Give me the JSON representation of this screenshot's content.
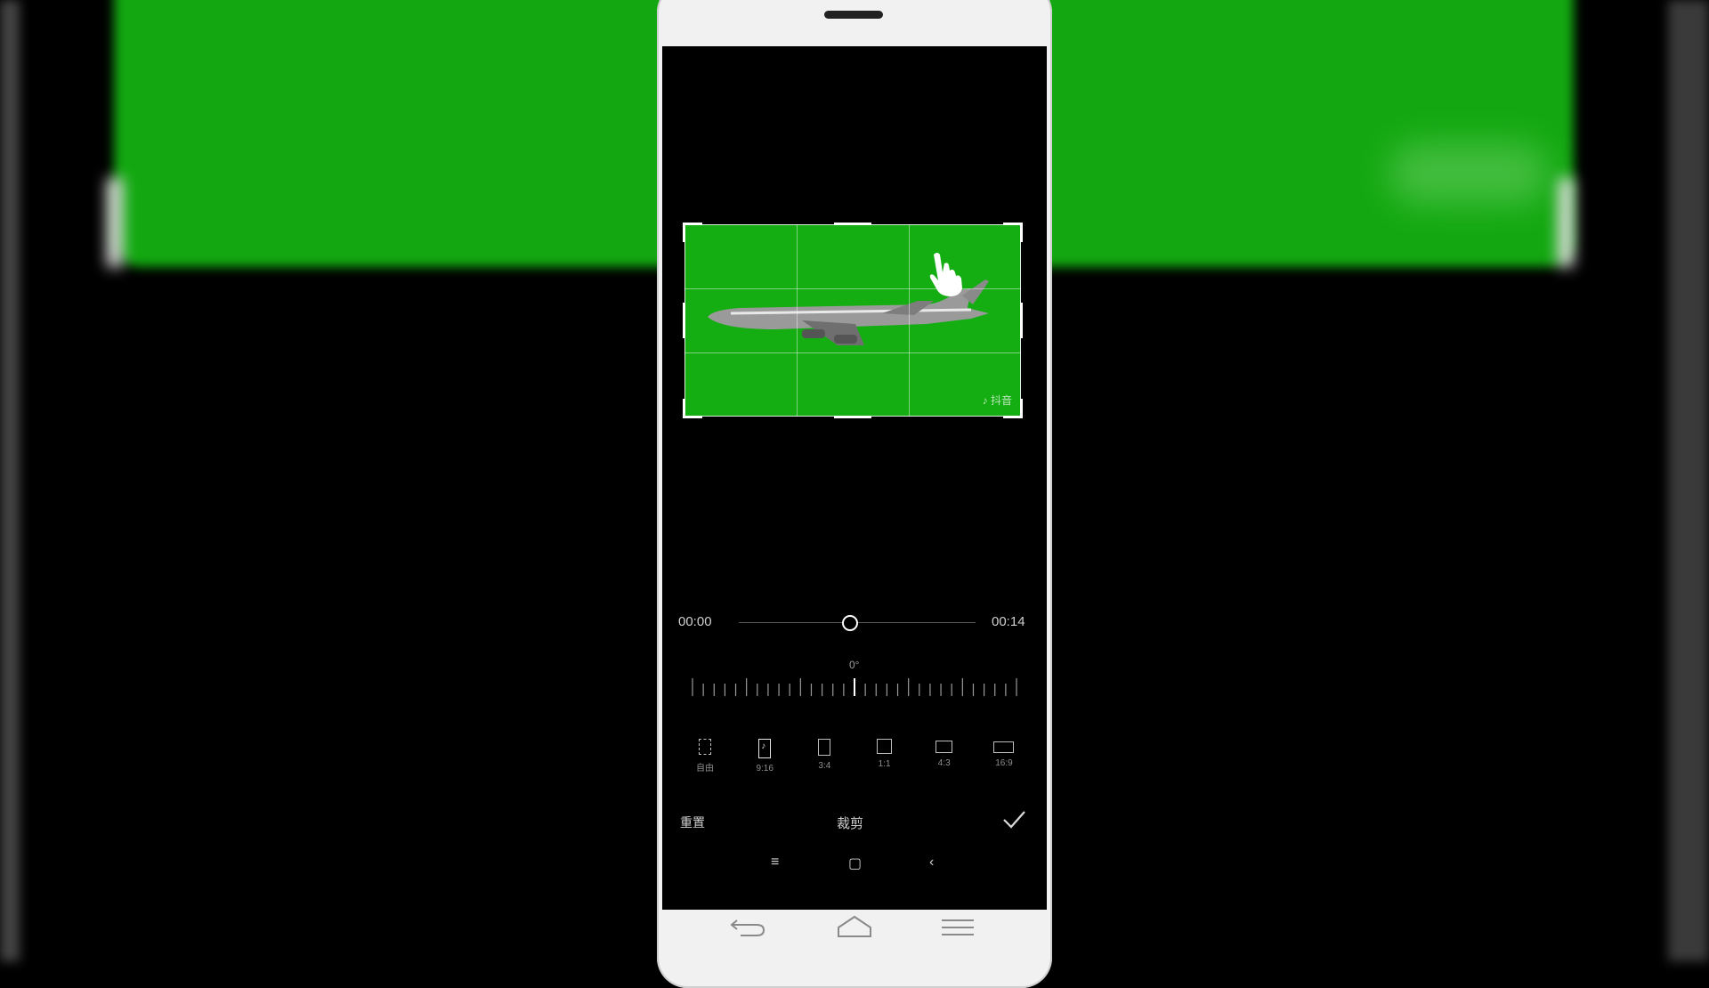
{
  "video": {
    "watermark": "♪ 抖音"
  },
  "timeline": {
    "start": "00:00",
    "end": "00:14",
    "position_fraction": 0.47
  },
  "rotation": {
    "value": "0°"
  },
  "ratios": [
    {
      "label": "自由",
      "icon": "free-ratio-icon"
    },
    {
      "label": "9:16",
      "icon": "tiktok-ratio-icon"
    },
    {
      "label": "3:4",
      "icon": "ratio-3-4-icon"
    },
    {
      "label": "1:1",
      "icon": "ratio-1-1-icon"
    },
    {
      "label": "4:3",
      "icon": "ratio-4-3-icon"
    },
    {
      "label": "16:9",
      "icon": "ratio-16-9-icon"
    }
  ],
  "actions": {
    "reset": "重置",
    "title": "裁剪",
    "confirm_icon": "check-icon"
  },
  "nav": {
    "menu": "≡",
    "home": "▢",
    "back": "‹"
  },
  "colors": {
    "green_screen": "#14ad12",
    "background": "#000000",
    "phone_body": "#f1f1f1"
  }
}
